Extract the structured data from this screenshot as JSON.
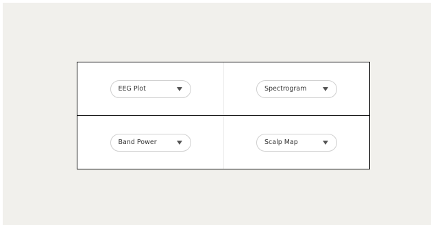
{
  "panels": [
    {
      "selected": "EEG Plot"
    },
    {
      "selected": "Spectrogram"
    },
    {
      "selected": "Band Power"
    },
    {
      "selected": "Scalp Map"
    }
  ],
  "icons": {
    "dropdown_arrow": "triangle-down-icon"
  },
  "colors": {
    "page_background": "#f1f0ec",
    "panel_background": "#ffffff",
    "grid_border": "#111111",
    "dropdown_border": "#cfcfcf",
    "arrow": "#555555"
  }
}
